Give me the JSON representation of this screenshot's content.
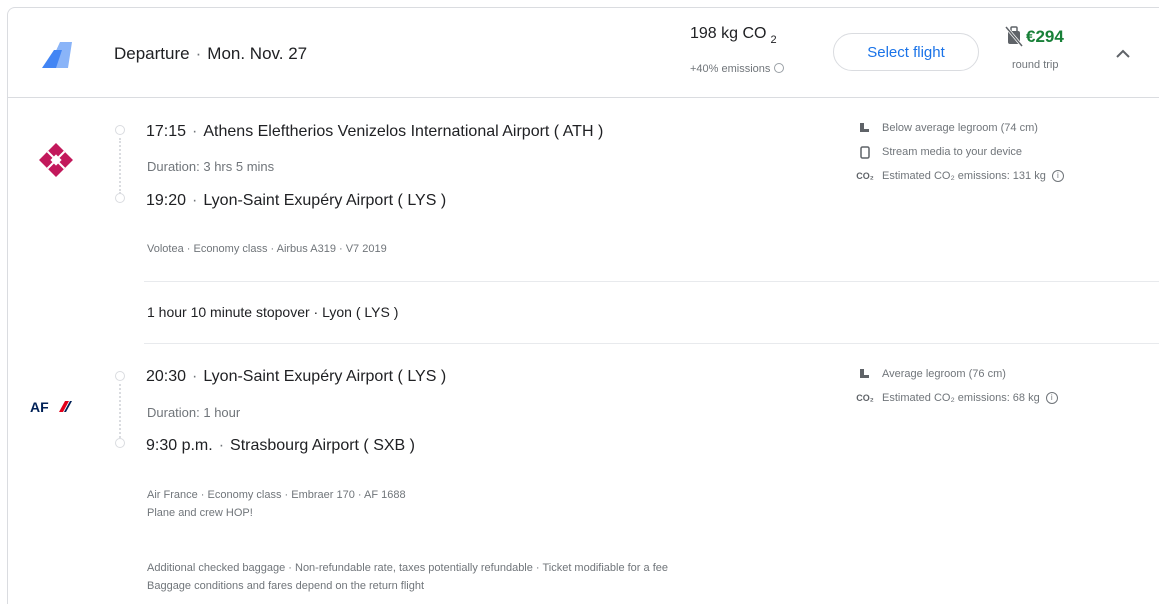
{
  "header": {
    "departure_label": "Departure",
    "separator": "·",
    "date": "Mon. Nov. 27",
    "co2_value": "198 kg CO",
    "co2_subscript": "2",
    "emissions_note": "+40% emissions",
    "select_label": "Select flight",
    "price": "€294",
    "price_note": "round trip"
  },
  "segments": [
    {
      "airline_logo": "volotea-logo",
      "departure_time": "17:15",
      "departure_airport": "Athens Eleftherios Venizelos International Airport ( ATH )",
      "duration": "Duration: 3 hrs 5 mins",
      "arrival_time": "19:20",
      "arrival_airport": "Lyon-Saint Exupéry Airport ( LYS )",
      "details": "Volotea · Economy class · Airbus A319 · V7 2019",
      "amenities": [
        {
          "icon": "legroom-icon",
          "text": "Below average legroom (74 cm)"
        },
        {
          "icon": "stream-media-icon",
          "text": "Stream media to your device"
        },
        {
          "icon": "co2-icon",
          "text": "Estimated CO₂ emissions: 131 kg"
        }
      ]
    },
    {
      "airline_logo": "air-france-logo",
      "departure_time": "20:30",
      "departure_airport": "Lyon-Saint Exupéry Airport ( LYS )",
      "duration": "Duration: 1 hour",
      "arrival_time": "9:30 p.m.",
      "arrival_airport": "Strasbourg Airport ( SXB )",
      "details": "Air France · Economy class · Embraer 170 · AF 1688",
      "operator": "Plane and crew HOP!",
      "amenities": [
        {
          "icon": "legroom-icon",
          "text": "Average legroom (76 cm)"
        },
        {
          "icon": "co2-icon",
          "text": "Estimated CO₂ emissions: 68 kg"
        }
      ]
    }
  ],
  "stopover": "1 hour 10 minute stopover · Lyon ( LYS )",
  "footer": {
    "fare_terms": "Additional checked baggage · Non-refundable rate, taxes potentially refundable · Ticket modifiable for a fee",
    "baggage_note": "Baggage conditions and fares depend on the return flight"
  },
  "colors": {
    "accent": "#1a73e8",
    "price": "#188038",
    "divider": "#dadce0"
  }
}
